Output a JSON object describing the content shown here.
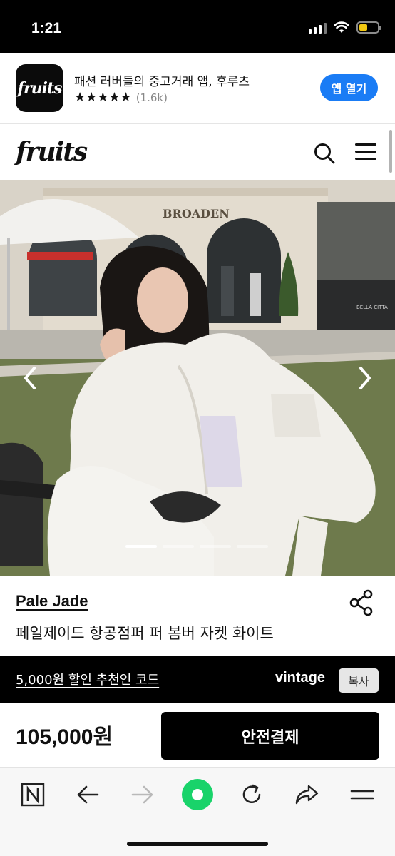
{
  "status_bar": {
    "time": "1:21",
    "battery_level": 0.45,
    "battery_color": "#f2c811"
  },
  "app_banner": {
    "icon_name": "fruits-app-icon",
    "icon_text": "fruits",
    "title": "패션 러버들의 중고거래 앱, 후루츠",
    "stars": "★★★★★",
    "rating_count": "(1.6k)",
    "open_button": "앱 열기",
    "button_color": "#1a7cf5"
  },
  "header": {
    "logo": "fruits",
    "icons": [
      "search-icon",
      "menu-icon"
    ]
  },
  "gallery": {
    "photo_sign": "BROADEN",
    "photo_sign_small": "BELLA CITTA",
    "slide_count": 4,
    "active_slide": 1,
    "icons": [
      "chevron-left-icon",
      "chevron-right-icon"
    ]
  },
  "product": {
    "brand": "Pale Jade",
    "name": "페일제이드 항공점퍼 퍼 봄버 자켓 화이트"
  },
  "coupon": {
    "text": "5,000원 할인 추천인 코드",
    "code": "vintage",
    "copy_button": "복사"
  },
  "purchase": {
    "price": "105,000원",
    "pay_button": "안전결제"
  },
  "browser_toolbar": {
    "icons": [
      "naver-n-icon",
      "back-arrow-icon",
      "forward-arrow-icon",
      "green-dot-icon",
      "refresh-icon",
      "share-arrow-icon",
      "hamburger-icon"
    ],
    "accent": "#19d36a"
  }
}
